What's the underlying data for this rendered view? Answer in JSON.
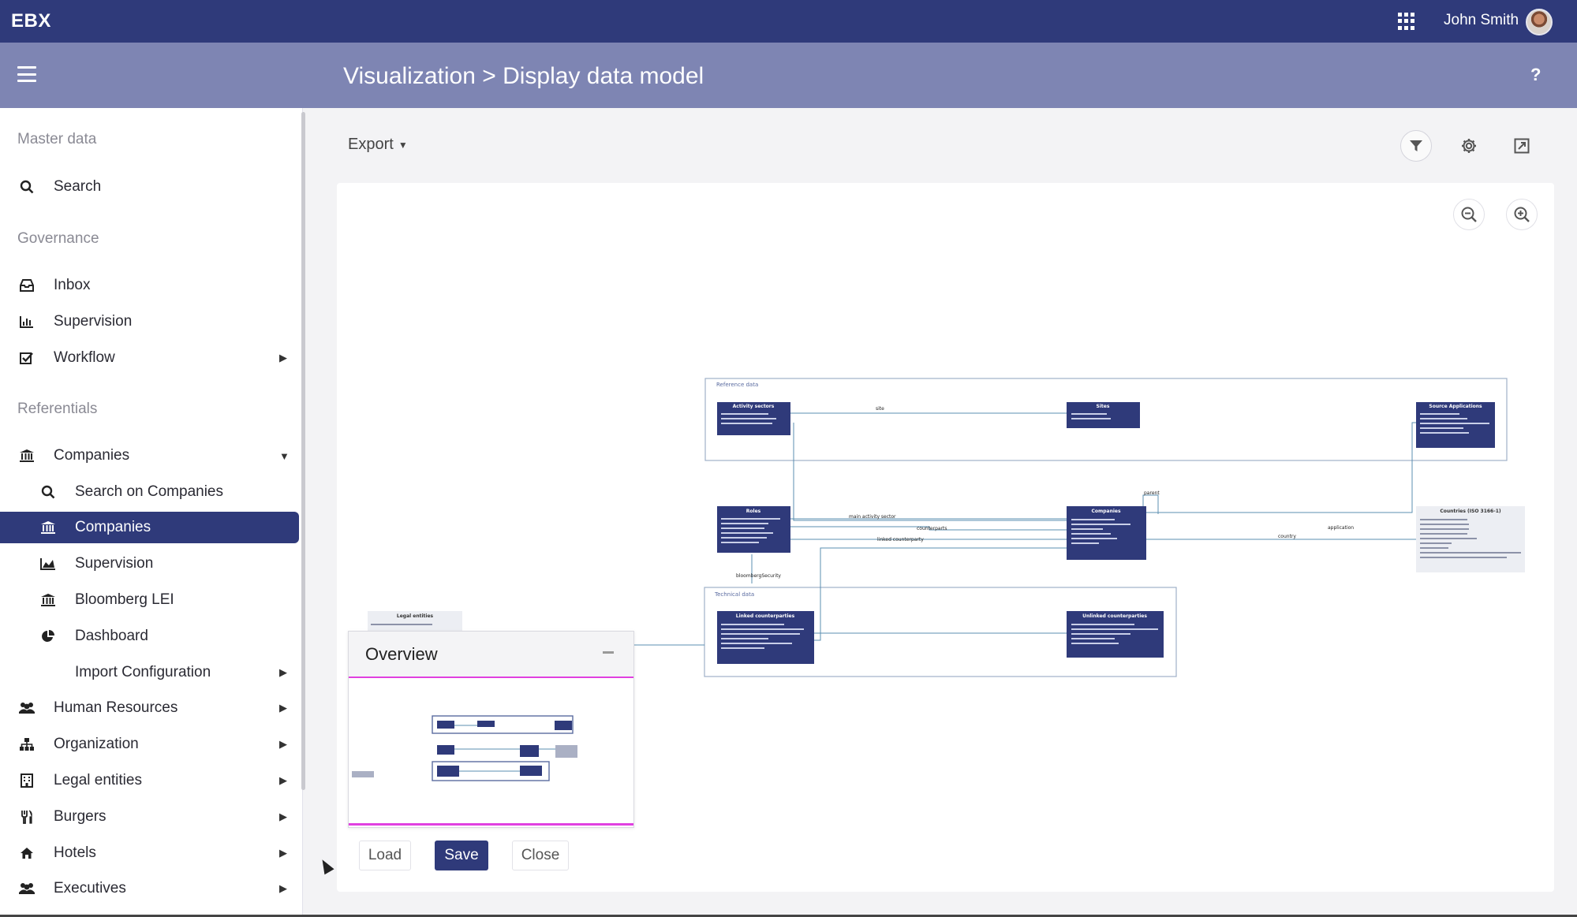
{
  "topbar": {
    "brand": "EBX",
    "user_name": "John Smith",
    "apps_icon": "grid-icon"
  },
  "header": {
    "title": "Visualization > Display data model",
    "help": "?"
  },
  "sidebar": {
    "sections": {
      "master_data": "Master data",
      "governance": "Governance",
      "referentials": "Referentials"
    },
    "items": [
      {
        "label": "Search",
        "icon": "search-icon"
      },
      {
        "label": "Inbox",
        "icon": "inbox-icon"
      },
      {
        "label": "Supervision",
        "icon": "bar-chart-icon"
      },
      {
        "label": "Workflow",
        "icon": "check-square-icon",
        "has_submenu": true
      },
      {
        "label": "Companies",
        "icon": "bank-icon",
        "expanded": true
      },
      {
        "label": "Search on Companies",
        "icon": "search-icon"
      },
      {
        "label": "Companies",
        "icon": "bank-icon",
        "selected": true
      },
      {
        "label": "Supervision",
        "icon": "area-chart-icon"
      },
      {
        "label": "Bloomberg LEI",
        "icon": "bank-icon"
      },
      {
        "label": "Dashboard",
        "icon": "pie-chart-icon"
      },
      {
        "label": "Import Configuration",
        "icon": "",
        "has_submenu": true
      },
      {
        "label": "Human Resources",
        "icon": "users-icon",
        "has_submenu": true
      },
      {
        "label": "Organization",
        "icon": "sitemap-icon",
        "has_submenu": true
      },
      {
        "label": "Legal entities",
        "icon": "building-icon",
        "has_submenu": true
      },
      {
        "label": "Burgers",
        "icon": "cutlery-icon",
        "has_submenu": true
      },
      {
        "label": "Hotels",
        "icon": "home-icon",
        "has_submenu": true
      },
      {
        "label": "Executives",
        "icon": "users-icon",
        "has_submenu": true
      }
    ]
  },
  "toolbar": {
    "export_label": "Export"
  },
  "diagram": {
    "groups": {
      "reference": "Reference data",
      "technical": "Technical data"
    },
    "entities": {
      "activity_sectors": "Activity sectors",
      "sites": "Sites",
      "source_applications": "Source Applications",
      "roles": "Roles",
      "companies": "Companies",
      "countries": "Countries (ISO 3166-1)",
      "linked": "Linked counterparties",
      "unlinked": "Unlinked counterparties",
      "legal": "Legal entities"
    },
    "relations": {
      "site": "site",
      "main_activity_sector": "main activity sector",
      "counterparts": "counterparts",
      "linked_counterparty": "linked counterparty",
      "bloomberg_security": "bloombergSecurity",
      "parent": "parent",
      "country": "country",
      "application": "application"
    }
  },
  "overview": {
    "title": "Overview"
  },
  "actions": {
    "load": "Load",
    "save": "Save",
    "close": "Close"
  },
  "colors": {
    "primary": "#2f3a7a",
    "subheader": "#7e85b3",
    "overview_accent": "#e040e0"
  }
}
